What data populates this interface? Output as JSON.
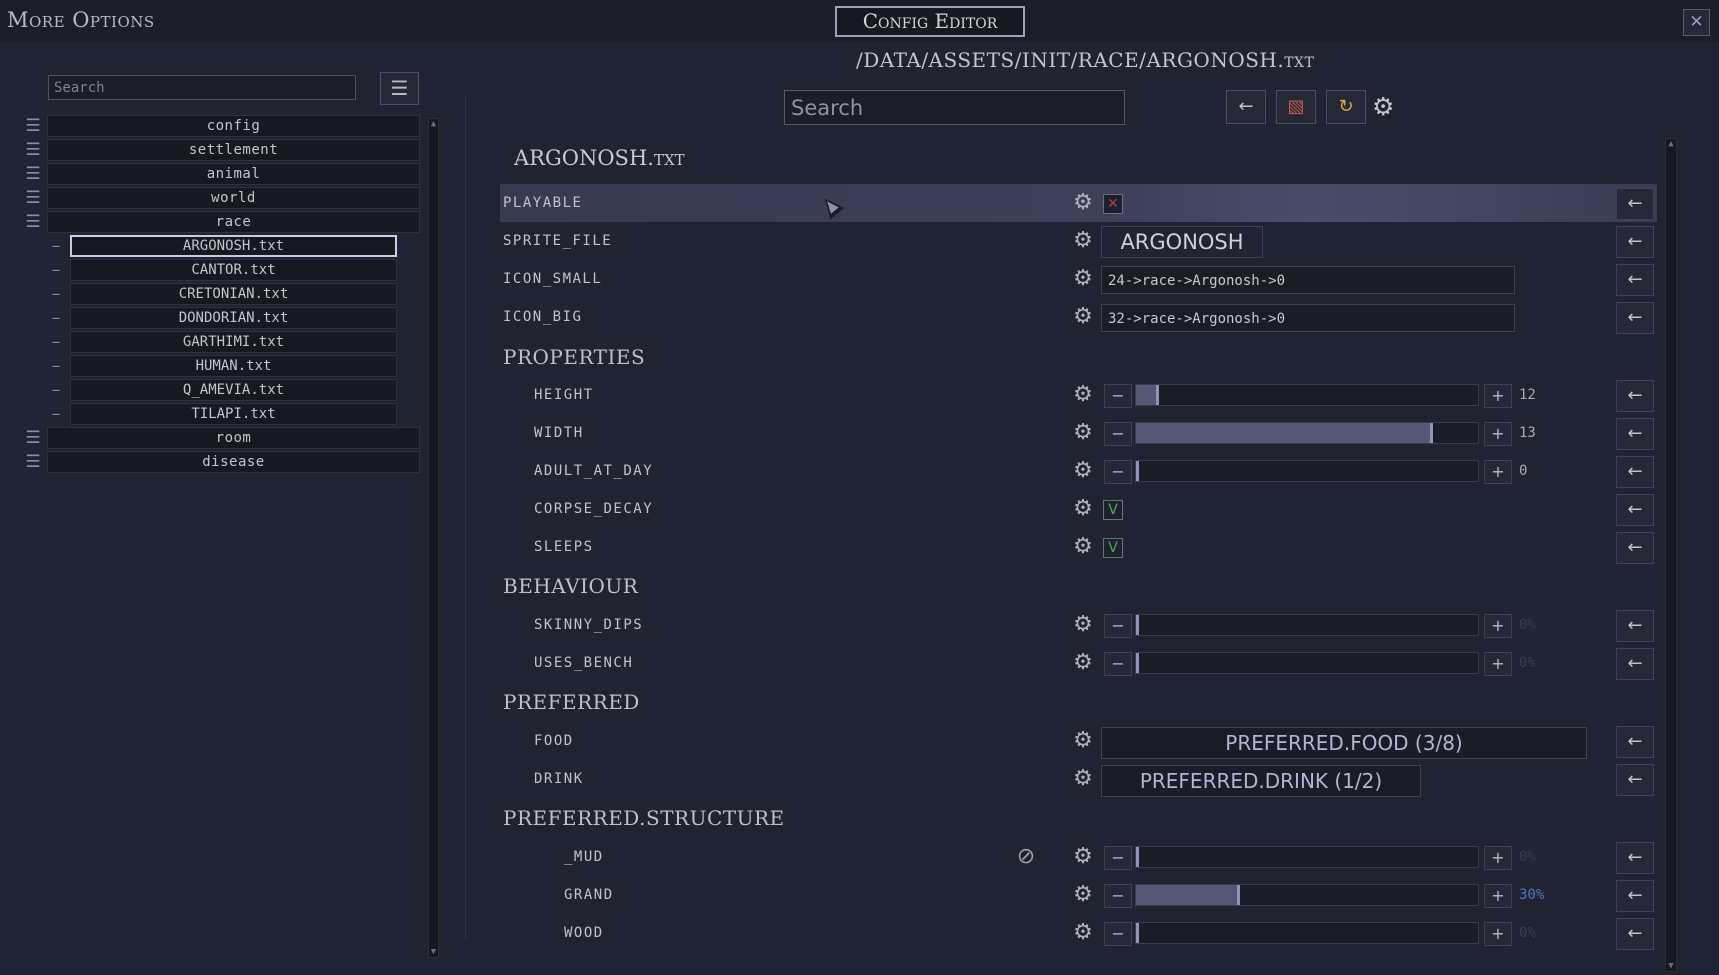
{
  "window": {
    "title": "More Options",
    "center_title": "Config Editor",
    "close_icon": "close-icon"
  },
  "left": {
    "search_placeholder": "Search",
    "menu_icon": "menu-icon",
    "folders_top": [
      "config",
      "settlement",
      "animal",
      "world",
      "race"
    ],
    "race_files": [
      "ARGONOSH.txt",
      "CANTOR.txt",
      "CRETONIAN.txt",
      "DONDORIAN.txt",
      "GARTHIMI.txt",
      "HUMAN.txt",
      "Q_AMEVIA.txt",
      "TILAPI.txt"
    ],
    "folders_bottom": [
      "room",
      "disease"
    ],
    "selected_file": "ARGONOSH.txt"
  },
  "editor": {
    "path": "/DATA/ASSETS/INIT/RACE/ARGONOSH.txt",
    "search_placeholder": "Search",
    "toolbar": {
      "back_icon": "←",
      "toggle_icon": "▧",
      "reload_icon": "↻",
      "settings_icon": "⚙"
    },
    "file_title": "ARGONOSH.txt",
    "fields": {
      "playable": {
        "label": "PLAYABLE",
        "value": "✕"
      },
      "sprite_file": {
        "label": "SPRITE_FILE",
        "value": "ARGONOSH"
      },
      "icon_small": {
        "label": "ICON_SMALL",
        "value": "24->race->Argonosh->0"
      },
      "icon_big": {
        "label": "ICON_BIG",
        "value": "32->race->Argonosh->0"
      }
    },
    "sections": {
      "properties": "PROPERTIES",
      "behaviour": "BEHAVIOUR",
      "preferred": "PREFERRED",
      "preferred_structure": "PREFERRED.STRUCTURE"
    },
    "properties": {
      "height": {
        "label": "HEIGHT",
        "value": "12",
        "level": 0.06
      },
      "width": {
        "label": "WIDTH",
        "value": "13",
        "level": 0.87
      },
      "adult_at_day": {
        "label": "ADULT_AT_DAY",
        "value": "0",
        "level": 0.0
      },
      "corpse_decay": {
        "label": "CORPSE_DECAY",
        "value": "V"
      },
      "sleeps": {
        "label": "SLEEPS",
        "value": "V"
      }
    },
    "behaviour": {
      "skinny_dips": {
        "label": "SKINNY_DIPS",
        "value": "0%",
        "level": 0.0
      },
      "uses_bench": {
        "label": "USES_BENCH",
        "value": "0%",
        "level": 0.0
      }
    },
    "preferred": {
      "food": {
        "label": "FOOD",
        "value": "PREFERRED.FOOD (3/8)"
      },
      "drink": {
        "label": "DRINK",
        "value": "PREFERRED.DRINK (1/2)"
      }
    },
    "structure": {
      "mud": {
        "label": "_MUD",
        "value": "0%",
        "level": 0.0
      },
      "grand": {
        "label": "GRAND",
        "value": "30%",
        "level": 0.3
      },
      "wood": {
        "label": "WOOD",
        "value": "0%",
        "level": 0.0
      }
    }
  }
}
